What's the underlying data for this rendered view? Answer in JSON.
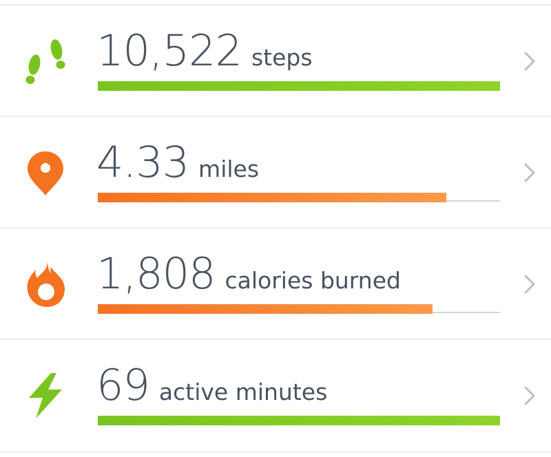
{
  "colors": {
    "green": "#7ac41f",
    "green_light": "#8fd32a",
    "orange": "#f47321",
    "orange_light": "#f99a4a",
    "text": "#4a5260",
    "chevron": "#b9bec6",
    "track": "#d4d4d4"
  },
  "stats": [
    {
      "icon": "footsteps-icon",
      "value": "10,522",
      "unit": "steps",
      "progress": 1.0,
      "color": "green"
    },
    {
      "icon": "location-pin-icon",
      "value": "4.33",
      "unit": "miles",
      "progress": 0.866,
      "color": "orange"
    },
    {
      "icon": "flame-icon",
      "value": "1,808",
      "unit": "calories burned",
      "progress": 0.832,
      "color": "orange"
    },
    {
      "icon": "lightning-bolt-icon",
      "value": "69",
      "unit": "active minutes",
      "progress": 1.0,
      "color": "green"
    }
  ]
}
